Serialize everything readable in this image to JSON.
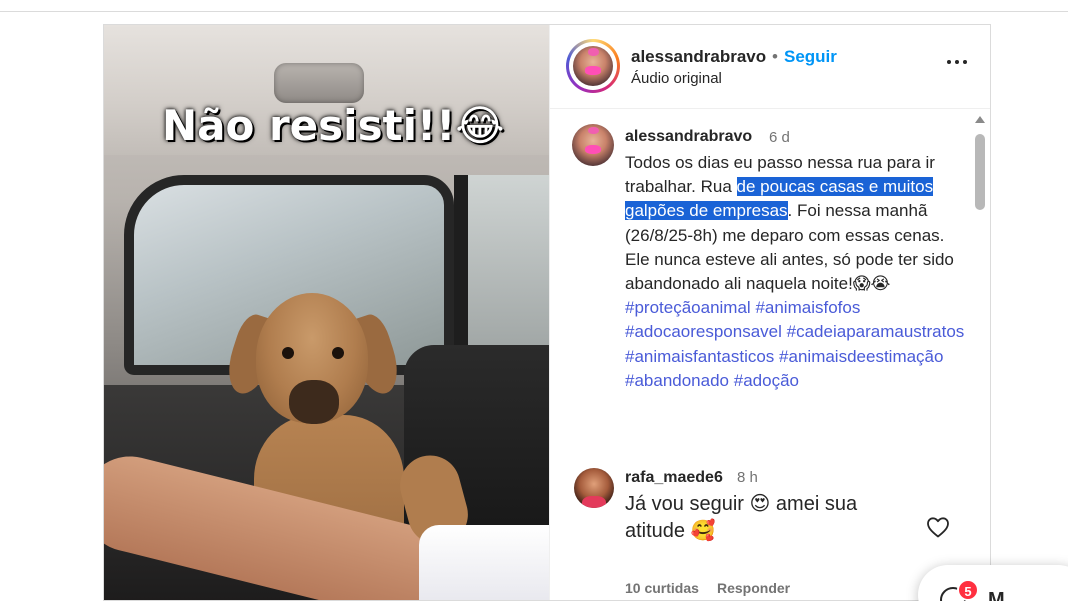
{
  "post": {
    "media": {
      "caption_overlay": "Não resisti!!😂"
    },
    "header": {
      "username": "alessandrabravo",
      "separator": "•",
      "follow_label": "Seguir",
      "audio": "Áudio original",
      "more_icon": "more-horizontal-icon"
    },
    "caption": {
      "username": "alessandrabravo",
      "time": "6 d",
      "text_before": "Todos os dias eu passo nessa rua para ir trabalhar. Rua ",
      "text_highlighted": "de poucas casas e muitos galpões de empresas",
      "text_after": ". Foi nessa manhã (26/8/25-8h) me deparo com essas cenas. Ele nunca esteve ali antes, só pode ter sido abandonado ali naquela noite!😱😭 ",
      "hashtags": [
        "#proteçãoanimal",
        "#animaisfofos",
        "#adocaoresponsavel",
        "#cadeiaparamaustratos",
        "#animaisfantasticos",
        "#animaisdeestimação",
        "#abandonado",
        "#adoção"
      ]
    },
    "reply": {
      "username": "rafa_maede6",
      "time": "8 h",
      "text": "Já vou seguir 😍 amei sua atitude 🥰",
      "likes": "10 curtidas",
      "reply_label": "Responder",
      "like_icon": "heart-outline-icon"
    }
  },
  "messages": {
    "badge_count": "5",
    "label": "M",
    "icon": "messenger-icon"
  },
  "colors": {
    "link_blue": "#0095f6",
    "hashtag": "#4a5bd8",
    "selection": "#1a63d6",
    "badge": "#ff3040"
  }
}
